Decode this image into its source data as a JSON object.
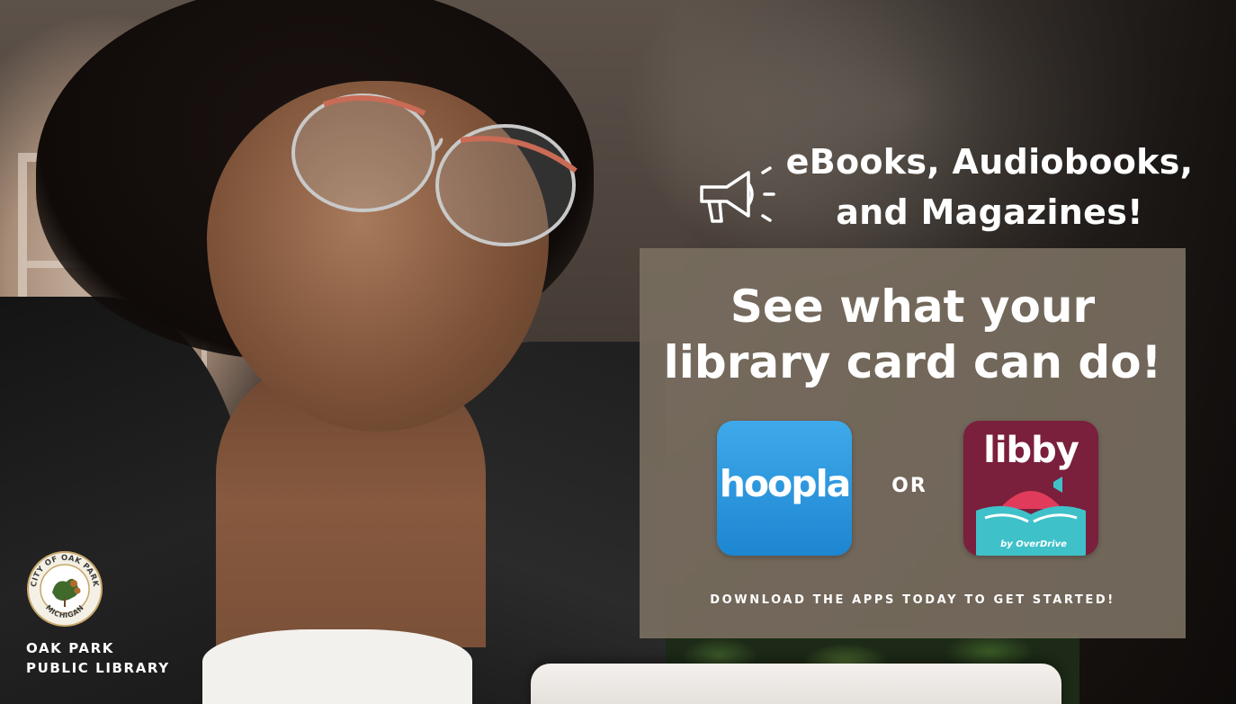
{
  "headline": {
    "line1": "eBooks, Audiobooks,",
    "line2": "and Magazines!",
    "icon": "megaphone-icon"
  },
  "panel": {
    "title_line1": "See what your",
    "title_line2": "library card can do!",
    "separator": "OR",
    "footer": "DOWNLOAD THE APPS TODAY TO GET STARTED!",
    "background_color": "#786e60"
  },
  "apps": {
    "hoopla": {
      "name": "hoopla",
      "color": "#1d86d2"
    },
    "libby": {
      "name": "libby",
      "byline": "by OverDrive",
      "color": "#7a1f3c"
    }
  },
  "library": {
    "name_line1": "OAK PARK",
    "name_line2": "PUBLIC LIBRARY",
    "seal_text": "CITY OF OAK PARK",
    "seal_subtext": "MICHIGAN"
  }
}
